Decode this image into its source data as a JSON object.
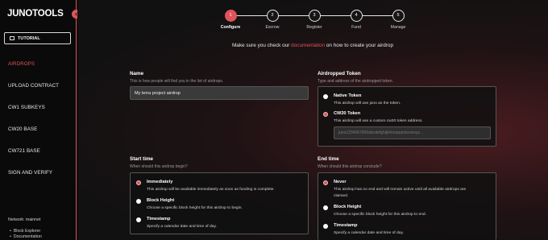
{
  "brand": {
    "name_a": "JUNO",
    "name_b": "TOOLS",
    "collapse_glyph": "‹"
  },
  "sidebar": {
    "tutorial_label": "TUTORIAL",
    "items": [
      {
        "label": "AIRDROPS",
        "active": true
      },
      {
        "label": "UPLOAD CONTRACT",
        "active": false
      },
      {
        "label": "CW1 SUBKEYS",
        "active": false
      },
      {
        "label": "CW20 BASE",
        "active": false
      },
      {
        "label": "CW721 BASE",
        "active": false
      },
      {
        "label": "SIGN AND VERIFY",
        "active": false
      }
    ],
    "network": "Network: mainnet",
    "links": [
      "Block Explorer",
      "Documentation"
    ]
  },
  "stepper": {
    "steps": [
      {
        "num": "1",
        "label": "Configure",
        "active": true
      },
      {
        "num": "2",
        "label": "Escrow",
        "active": false
      },
      {
        "num": "3",
        "label": "Register",
        "active": false
      },
      {
        "num": "4",
        "label": "Fund",
        "active": false
      },
      {
        "num": "5",
        "label": "Manage",
        "active": false
      }
    ]
  },
  "notice": {
    "before": "Make sure you check our ",
    "link": "documentation",
    "after": " on how to create your airdrop"
  },
  "name_field": {
    "title": "Name",
    "subtitle": "This is how people will find you in the list of airdrops.",
    "value": "My terra project airdrop"
  },
  "token_field": {
    "title": "Airdropped Token",
    "subtitle": "Type and address of the airdropped token.",
    "options": [
      {
        "label": "Native Token",
        "desc": "This airdrop will use juno as the token.",
        "checked": false
      },
      {
        "label": "CW20 Token",
        "desc": "This airdrop will use a custom cw20 token address.",
        "checked": true
      }
    ],
    "address_placeholder": "juno1234567890abcdefghijklmnopqrstuvwxyz..."
  },
  "start_field": {
    "title": "Start time",
    "subtitle": "When should this airdrop begin?",
    "options": [
      {
        "label": "Immediately",
        "desc": "This airdrop will be available immediately as soon as funding is complete.",
        "checked": true
      },
      {
        "label": "Block Height",
        "desc": "Choose a specific block height for this airdrop to begin.",
        "checked": false
      },
      {
        "label": "Timestamp",
        "desc": "Specify a calendar date and time of day.",
        "checked": false
      }
    ]
  },
  "end_field": {
    "title": "End time",
    "subtitle": "When should this airdrop conclude?",
    "options": [
      {
        "label": "Never",
        "desc_line1": "This airdrop has no end and will remain active until all available airdrops are",
        "desc_line2": "claimed.",
        "checked": true
      },
      {
        "label": "Block Height",
        "desc_line1": "Choose a specific block height for this airdrop to end.",
        "checked": false
      },
      {
        "label": "Timestamp",
        "desc_line1": "Specify a calendar date and time of day.",
        "checked": false
      }
    ]
  },
  "colors": {
    "accent": "#e0535a",
    "background": "#0b0b0b"
  }
}
